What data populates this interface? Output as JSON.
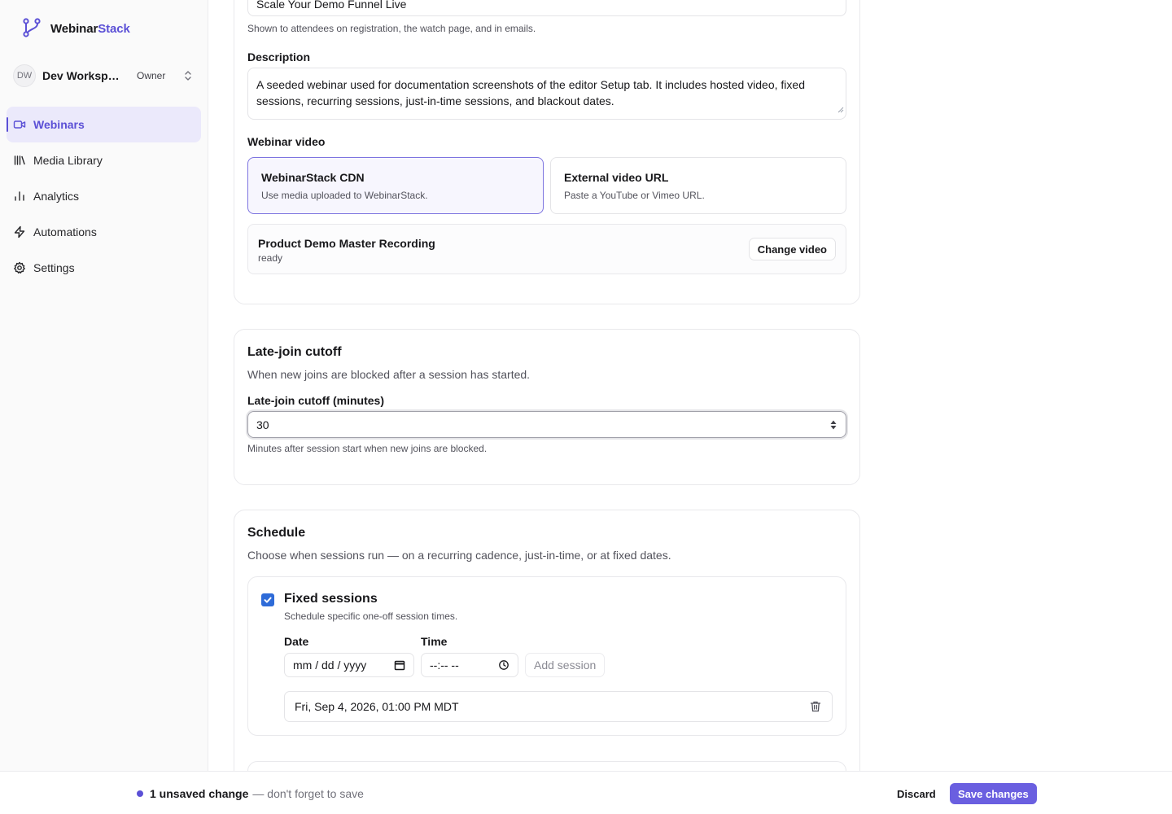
{
  "brand": {
    "name_prefix": "Webinar",
    "name_accent": "Stack",
    "accent_color": "#5b50d6"
  },
  "workspace": {
    "initials": "DW",
    "name": "Dev Workspace",
    "role": "Owner"
  },
  "nav": [
    {
      "label": "Webinars",
      "icon": "video-icon",
      "active": true
    },
    {
      "label": "Media Library",
      "icon": "library-icon"
    },
    {
      "label": "Analytics",
      "icon": "bar-chart-icon"
    },
    {
      "label": "Automations",
      "icon": "lightning-icon"
    },
    {
      "label": "Settings",
      "icon": "gear-icon"
    }
  ],
  "details": {
    "title_value": "Scale Your Demo Funnel Live",
    "title_helper": "Shown to attendees on registration, the watch page, and in emails.",
    "description_label": "Description",
    "description_value": "A seeded webinar used for documentation screenshots of the editor Setup tab. It includes hosted video, fixed sessions, recurring sessions, just-in-time sessions, and blackout dates.",
    "video_label": "Webinar video",
    "video_options": [
      {
        "title": "WebinarStack CDN",
        "description": "Use media uploaded to WebinarStack.",
        "selected": true
      },
      {
        "title": "External video URL",
        "description": "Paste a YouTube or Vimeo URL.",
        "selected": false
      }
    ],
    "media": {
      "title": "Product Demo Master Recording",
      "status": "ready",
      "change_label": "Change video"
    }
  },
  "late_join": {
    "title": "Late-join cutoff",
    "subtitle": "When new joins are blocked after a session has started.",
    "field_label": "Late-join cutoff (minutes)",
    "value": "30",
    "helper": "Minutes after session start when new joins are blocked."
  },
  "schedule": {
    "title": "Schedule",
    "subtitle": "Choose when sessions run — on a recurring cadence, just-in-time, or at fixed dates.",
    "fixed": {
      "checked": true,
      "title": "Fixed sessions",
      "description": "Schedule specific one-off session times.",
      "date_label": "Date",
      "date_placeholder": "mm / dd / yyyy",
      "time_label": "Time",
      "time_placeholder": "--:-- --",
      "add_label": "Add session",
      "sessions": [
        "Fri, Sep 4, 2026, 01:00 PM MDT"
      ]
    }
  },
  "footer": {
    "unsaved_count": "1 unsaved change",
    "unsaved_hint": "— don't forget to save",
    "discard_label": "Discard",
    "save_label": "Save changes",
    "save_color": "#6a5fe0"
  }
}
